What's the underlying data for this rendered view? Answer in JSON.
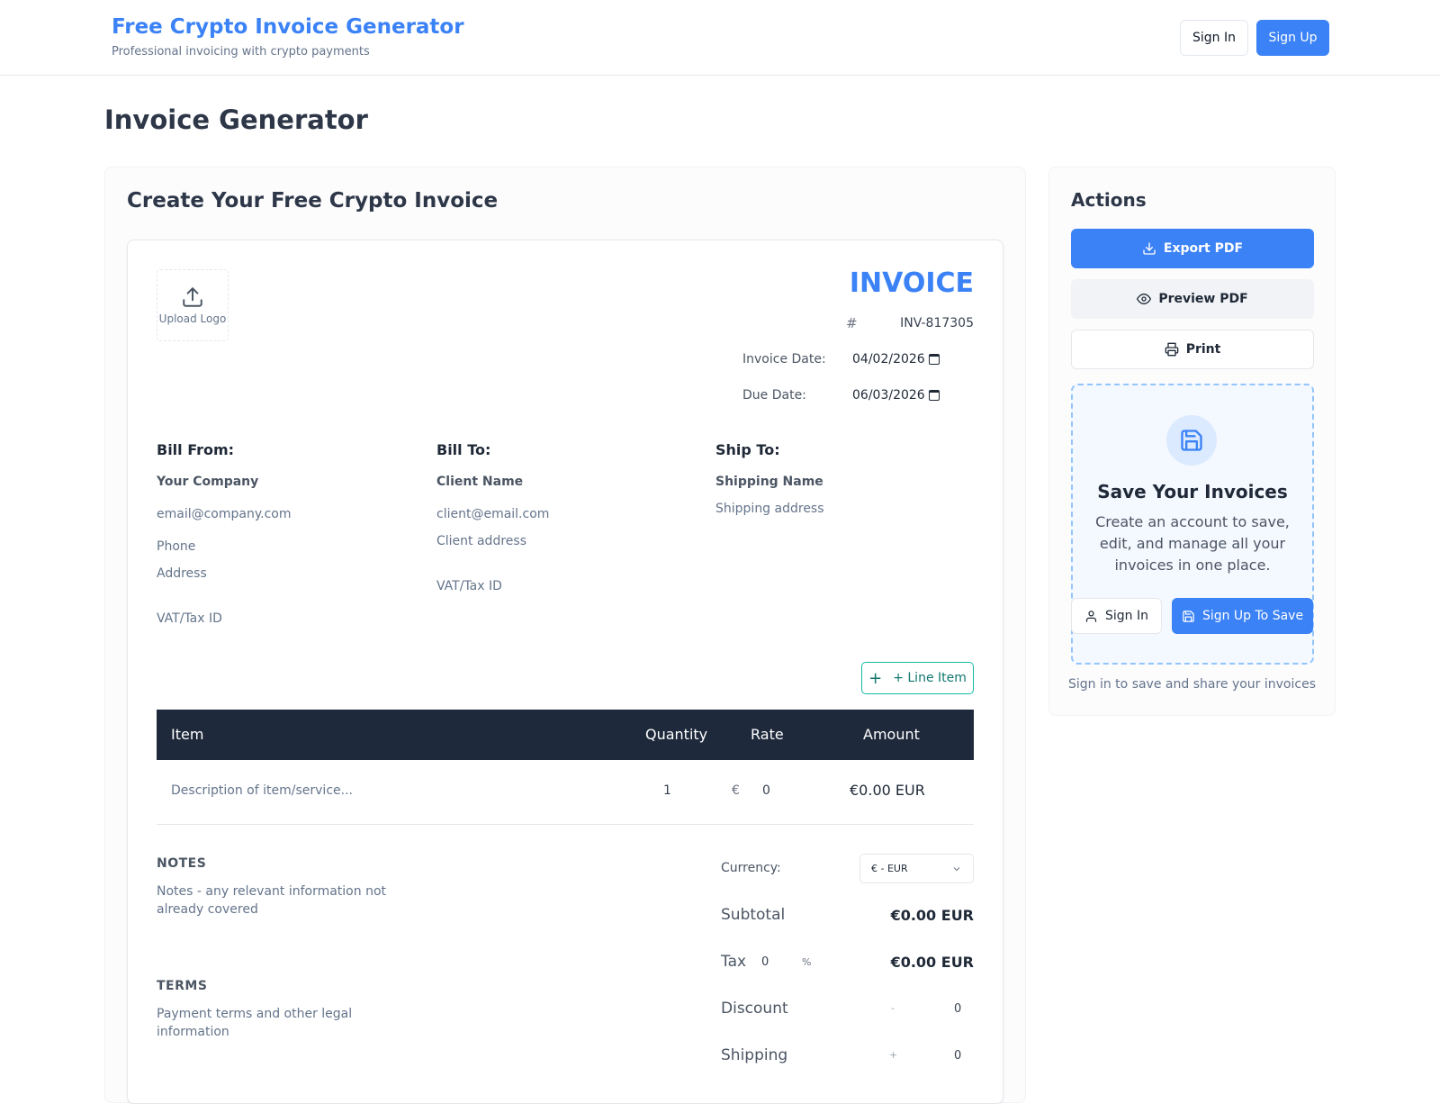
{
  "header": {
    "brand_title": "Free Crypto Invoice Generator",
    "brand_subtitle": "Professional invoicing with crypto payments",
    "signin_label": "Sign In",
    "signup_label": "Sign Up"
  },
  "page_title": "Invoice Generator",
  "main": {
    "card_title": "Create Your Free Crypto Invoice",
    "logo_label": "Upload Logo",
    "invoice_heading": "INVOICE",
    "hash": "#",
    "invoice_number": "INV-817305",
    "invoice_date_label": "Invoice Date:",
    "invoice_date": "04/02/2026",
    "due_date_label": "Due Date:",
    "due_date": "06/03/2026",
    "bill_from": {
      "heading": "Bill From:",
      "name": "Your Company",
      "email": "email@company.com",
      "phone": "Phone",
      "address": "Address",
      "vat": "VAT/Tax ID"
    },
    "bill_to": {
      "heading": "Bill To:",
      "name": "Client Name",
      "email": "client@email.com",
      "address": "Client address",
      "vat": "VAT/Tax ID"
    },
    "ship_to": {
      "heading": "Ship To:",
      "name": "Shipping Name",
      "address": "Shipping address"
    },
    "add_line_label": "+ Line Item",
    "table": {
      "headers": [
        "Item",
        "Quantity",
        "Rate",
        "Amount"
      ],
      "rows": [
        {
          "item": "Description of item/service...",
          "quantity": "1",
          "rate_symbol": "€",
          "rate": "0",
          "amount": "€0.00 EUR"
        }
      ]
    },
    "notes_label": "NOTES",
    "notes_placeholder": "Notes - any relevant information not already covered",
    "terms_label": "TERMS",
    "terms_placeholder": "Payment terms and other legal information",
    "summary": {
      "currency_label": "Currency:",
      "currency_value": "€ - EUR",
      "subtotal_label": "Subtotal",
      "subtotal_value": "€0.00 EUR",
      "tax_label": "Tax",
      "tax_rate": "0",
      "tax_unit": "%",
      "tax_value": "€0.00 EUR",
      "discount_label": "Discount",
      "discount_sign": "-",
      "discount_value": "0",
      "shipping_label": "Shipping",
      "shipping_sign": "+",
      "shipping_value": "0"
    }
  },
  "actions": {
    "title": "Actions",
    "export_label": "Export PDF",
    "preview_label": "Preview PDF",
    "print_label": "Print",
    "save_title": "Save Your Invoices",
    "save_desc": "Create an account to save, edit, and manage all your invoices in one place.",
    "save_signin_label": "Sign In",
    "save_signup_label": "Sign Up To Save",
    "footer_note": "Sign in to save and share your invoices"
  },
  "colors": {
    "accent": "#3b82f6",
    "table_header": "#1e293b",
    "teal": "#14b8a6"
  }
}
